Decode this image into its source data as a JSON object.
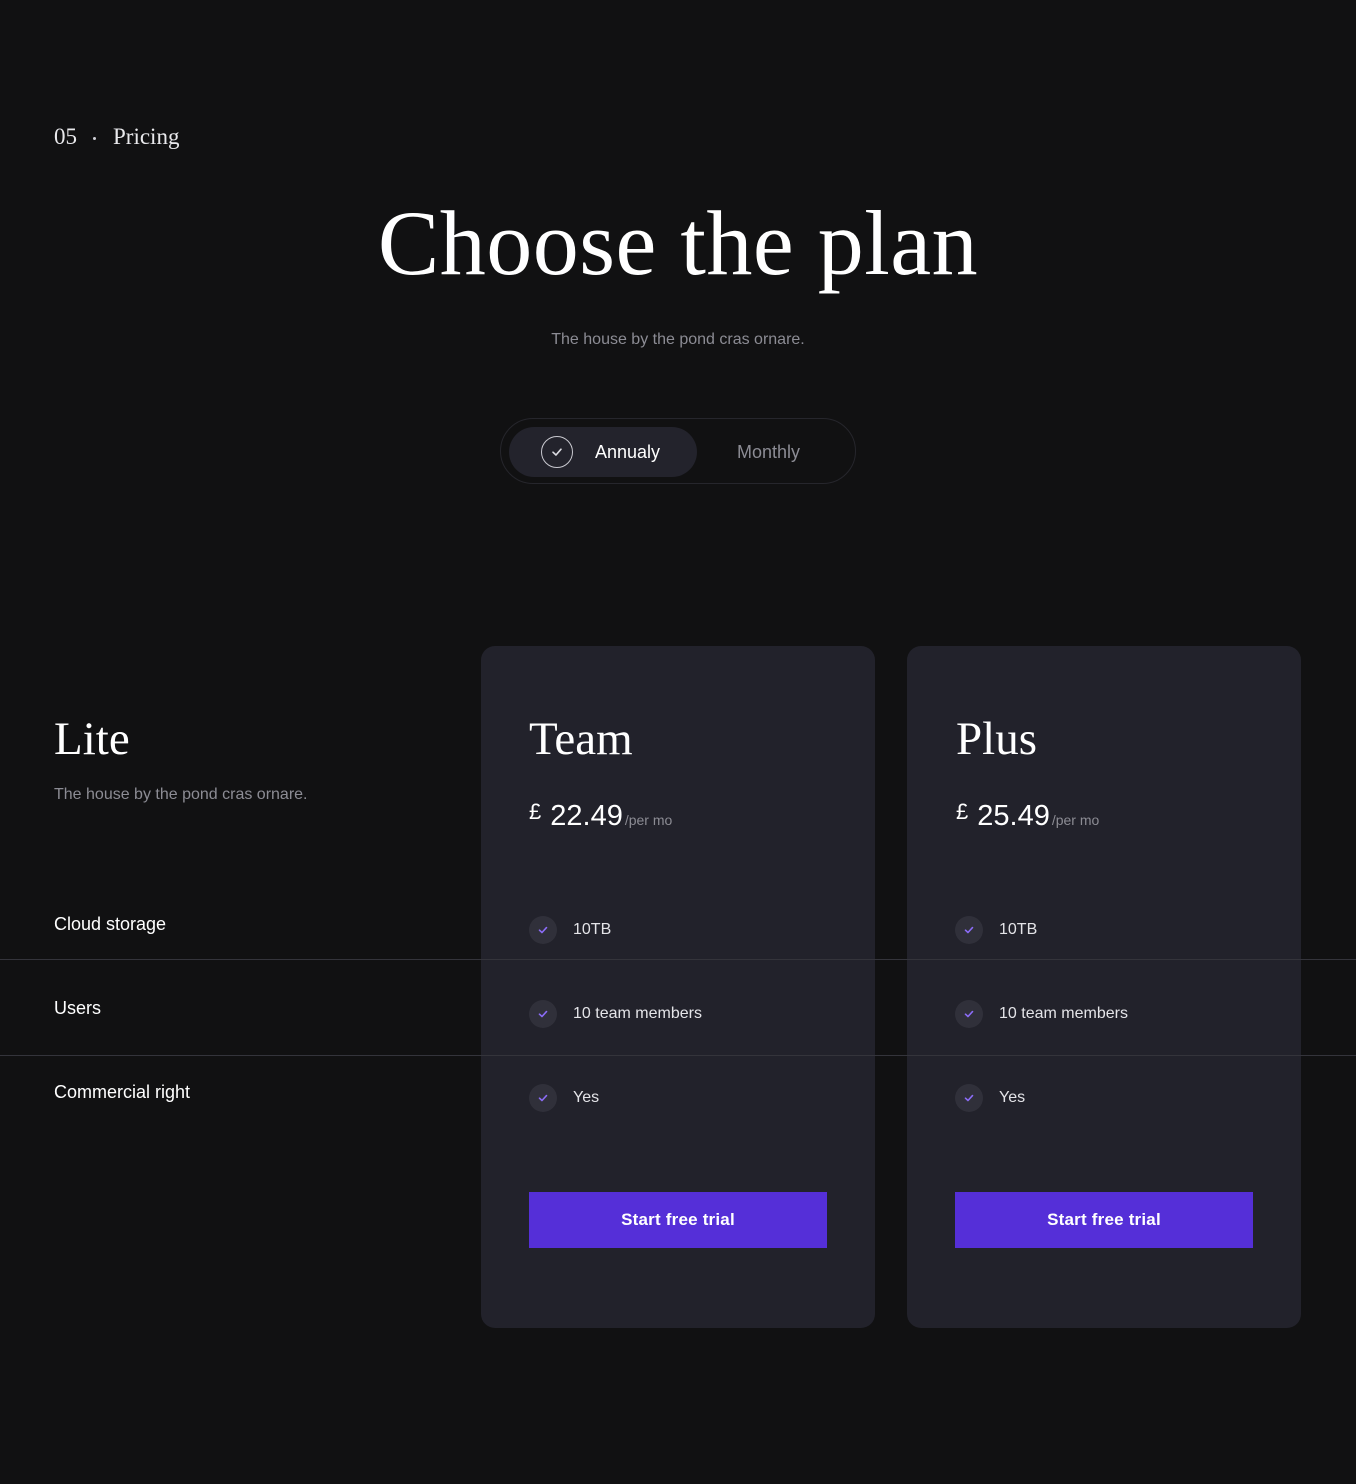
{
  "section": {
    "number": "05",
    "name": "Pricing"
  },
  "header": {
    "title": "Choose the plan",
    "subtitle": "The house by the pond cras ornare."
  },
  "billing_toggle": {
    "options": [
      {
        "label": "Annualy",
        "selected": true
      },
      {
        "label": "Monthly",
        "selected": false
      }
    ]
  },
  "lite": {
    "name": "Lite",
    "description": "The house by the pond cras ornare."
  },
  "feature_labels": [
    "Cloud storage",
    "Users",
    "Commercial right"
  ],
  "plans": [
    {
      "name": "Team",
      "currency": "£",
      "price": "22.49",
      "period": "/per mo",
      "features": [
        "10TB",
        "10 team members",
        "Yes"
      ],
      "cta": "Start free trial"
    },
    {
      "name": "Plus",
      "currency": "£",
      "price": "25.49",
      "period": "/per mo",
      "features": [
        "10TB",
        "10 team members",
        "Yes"
      ],
      "cta": "Start free trial"
    }
  ],
  "colors": {
    "background": "#111112",
    "card": "#22222b",
    "accent": "#552fd8",
    "check": "#8b6cf6",
    "muted_text": "#8c8c94"
  }
}
